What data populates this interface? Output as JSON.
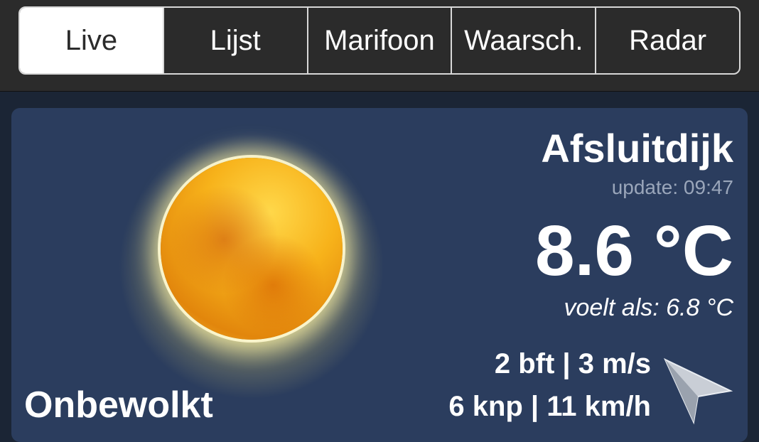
{
  "tabs": [
    {
      "label": "Live",
      "active": true
    },
    {
      "label": "Lijst",
      "active": false
    },
    {
      "label": "Marifoon",
      "active": false
    },
    {
      "label": "Waarsch.",
      "active": false
    },
    {
      "label": "Radar",
      "active": false
    }
  ],
  "weather": {
    "location": "Afsluitdijk",
    "update": "update: 09:47",
    "temperature": "8.6 °C",
    "feels_like": "voelt als: 6.8 °C",
    "wind_line1": "2 bft | 3 m/s",
    "wind_line2": "6 knp | 11 km/h",
    "condition": "Onbewolkt",
    "icon": "sun-icon",
    "wind_icon": "wind-direction-arrow-icon"
  },
  "colors": {
    "topbar": "#2b2b2b",
    "panel": "#2b3d5e",
    "active_tab": "#ffffff",
    "muted_text": "#9aa6ba"
  }
}
